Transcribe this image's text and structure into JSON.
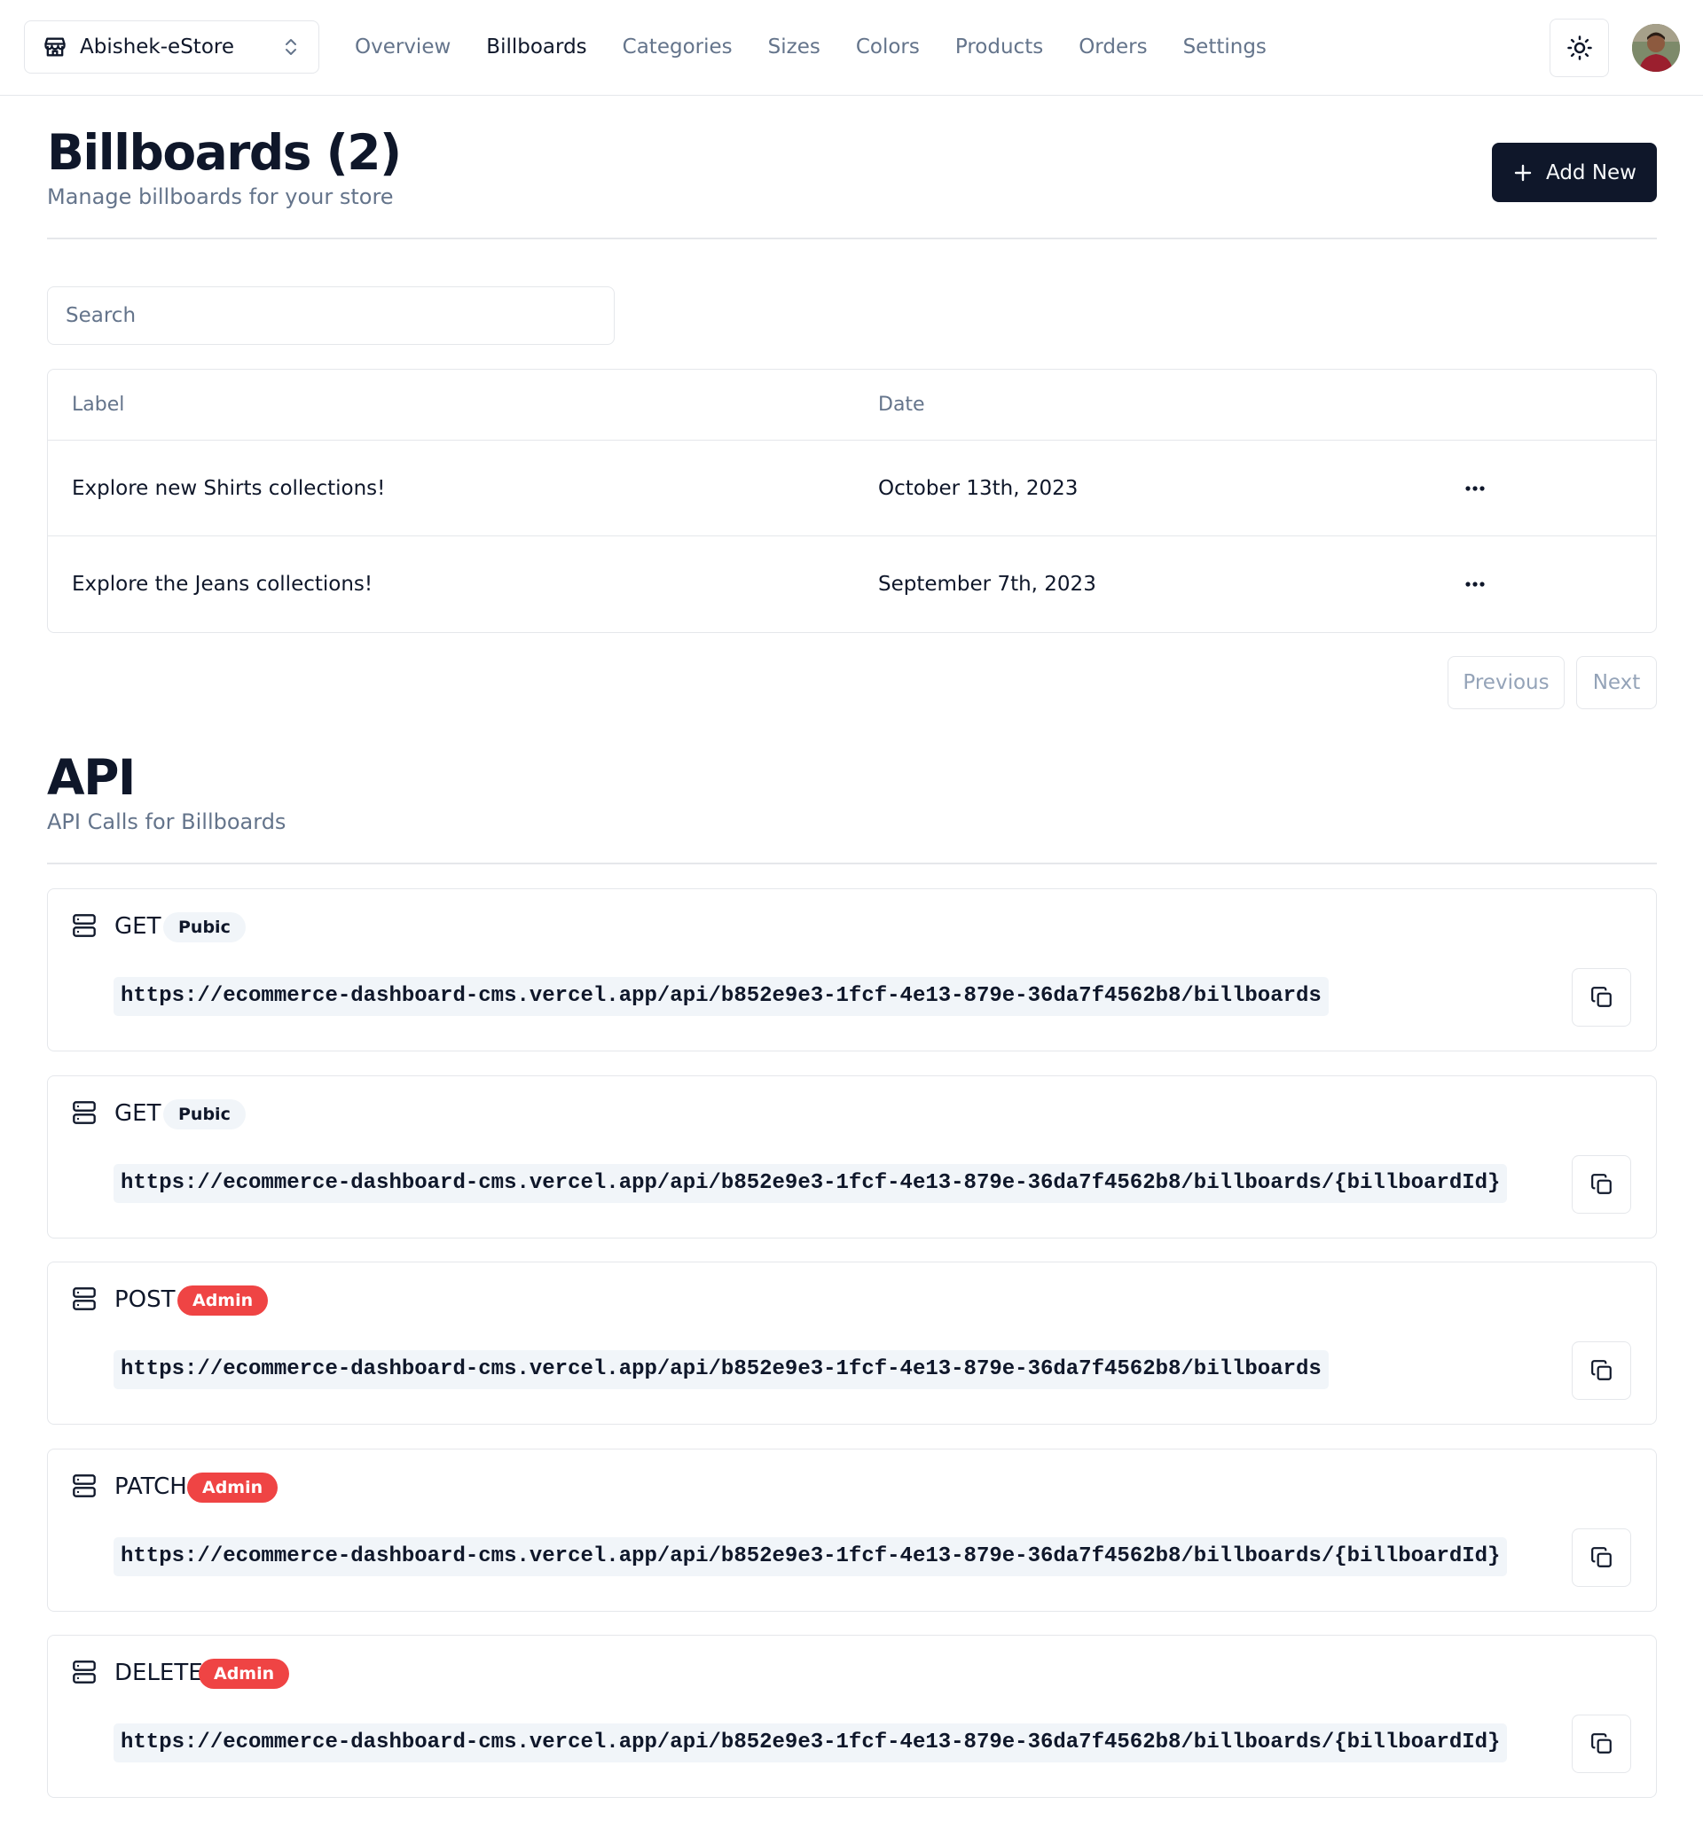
{
  "navbar": {
    "store_name": "Abishek-eStore",
    "links": [
      "Overview",
      "Billboards",
      "Categories",
      "Sizes",
      "Colors",
      "Products",
      "Orders",
      "Settings"
    ],
    "active_link": "Billboards"
  },
  "header": {
    "title": "Billboards (2)",
    "subtitle": "Manage billboards for your store",
    "add_label": "Add New"
  },
  "search": {
    "placeholder": "Search",
    "value": ""
  },
  "table": {
    "columns": [
      "Label",
      "Date"
    ],
    "rows": [
      {
        "label": "Explore new Shirts collections!",
        "date": "October 13th, 2023"
      },
      {
        "label": "Explore the Jeans collections!",
        "date": "September 7th, 2023"
      }
    ]
  },
  "pagination": {
    "previous": "Previous",
    "next": "Next"
  },
  "api": {
    "title": "API",
    "subtitle": "API Calls for Billboards",
    "entries": [
      {
        "method": "GET",
        "badge": "Pubic",
        "variant": "public",
        "url": "https://ecommerce-dashboard-cms.vercel.app/api/b852e9e3-1fcf-4e13-879e-36da7f4562b8/billboards"
      },
      {
        "method": "GET",
        "badge": "Pubic",
        "variant": "public",
        "url": "https://ecommerce-dashboard-cms.vercel.app/api/b852e9e3-1fcf-4e13-879e-36da7f4562b8/billboards/{billboardId}"
      },
      {
        "method": "POST",
        "badge": "Admin",
        "variant": "admin",
        "url": "https://ecommerce-dashboard-cms.vercel.app/api/b852e9e3-1fcf-4e13-879e-36da7f4562b8/billboards"
      },
      {
        "method": "PATCH",
        "badge": "Admin",
        "variant": "admin",
        "url": "https://ecommerce-dashboard-cms.vercel.app/api/b852e9e3-1fcf-4e13-879e-36da7f4562b8/billboards/{billboardId}"
      },
      {
        "method": "DELETE",
        "badge": "Admin",
        "variant": "admin",
        "url": "https://ecommerce-dashboard-cms.vercel.app/api/b852e9e3-1fcf-4e13-879e-36da7f4562b8/billboards/{billboardId}"
      }
    ]
  },
  "colors": {
    "primary": "#0f172a",
    "muted": "#64748b",
    "border": "#e5e7eb",
    "admin_badge": "#ef4444",
    "public_badge": "#f1f5f9"
  },
  "icons": {
    "store": "store-icon",
    "switcher": "chevrons-up-down-icon",
    "theme": "sun-icon",
    "add": "plus-icon",
    "row_actions": "more-horizontal-icon",
    "api_method": "server-icon",
    "copy": "copy-icon"
  }
}
